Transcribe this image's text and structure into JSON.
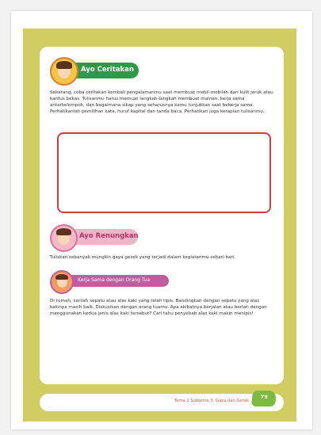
{
  "sections": {
    "ceritakan": {
      "title": "Ayo Ceritakan",
      "body": "Sekarang, coba ceritakan kembali pengalamanmu saat membuat mobil-mobilan dari kulit jeruk atau kardus bekas. Tulisanmu harus memuat langkah-langkah membuat mainan, kerja sama antarkelompok, dan bagaimana sikap yang seharusnya kamu tunjukkan saat bekerja sama. Perhatikanlah pemilihan kata, huruf kapital dan tanda baca. Perhatikan juga kerapian tulisanmu."
    },
    "renungkan": {
      "title": "Ayo Renungkan",
      "body": "Tuliskan sebanyak mungkin gaya gesek yang terjadi dalam kegiatanmu sehari-hari."
    },
    "kerja_sama": {
      "title": "Kerja Sama dengan Orang Tua",
      "body": "Di rumah, carilah sepatu atau alas kaki  yang telah tipis. Bandingkan dengan sepatu yang alas kakinya masih baik. Diskusikan dengan orang tuamu. Apa akibatnya berjalan atau berlari dengan menggunakan kedua jenis alas kaki tersebut? Cari tahu penyebab alas kaki makin menipis!"
    }
  },
  "footer": {
    "text": "Tema 2 Subtema 3: Gaya dan Gerak",
    "page_number": "79"
  },
  "colors": {
    "frame": "#d2cd63",
    "green_badge": "#2f9a44",
    "pink_badge": "#eeb7c8",
    "purple_badge": "#c15d9e",
    "answer_border": "#d43b40",
    "page_tag": "#7dbb3f"
  },
  "icons": [
    "girl-writing-icon",
    "girl-thinking-icon",
    "family-icon"
  ]
}
